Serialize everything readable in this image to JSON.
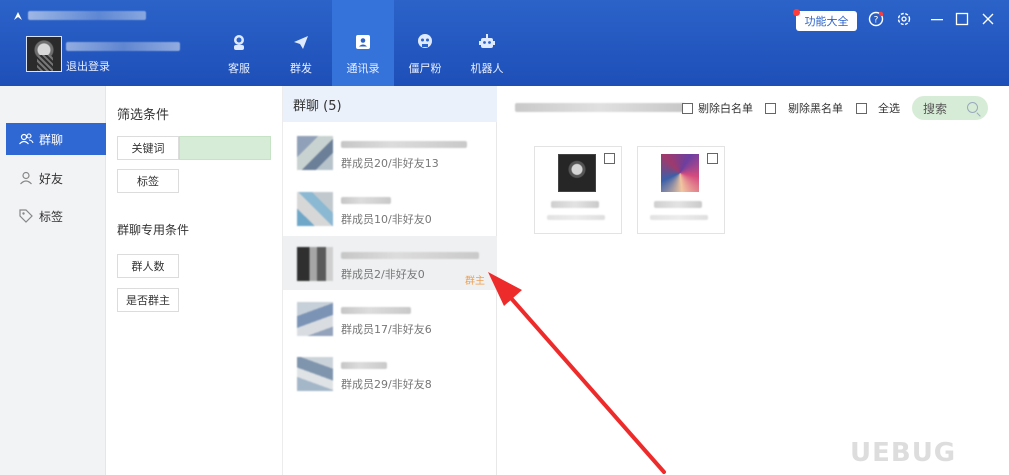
{
  "header": {
    "logout_label": "退出登录",
    "nav": [
      {
        "label": "客服",
        "icon": "customer-service-icon",
        "active": false
      },
      {
        "label": "群发",
        "icon": "send-plane-icon",
        "active": false
      },
      {
        "label": "通讯录",
        "icon": "contacts-icon",
        "active": true
      },
      {
        "label": "僵尸粉",
        "icon": "zombie-icon",
        "active": false
      },
      {
        "label": "机器人",
        "icon": "robot-icon",
        "active": false
      }
    ],
    "func_button": "功能大全",
    "accent": "#2b63c9"
  },
  "sidebar": {
    "items": [
      {
        "label": "群聊",
        "icon": "group-icon",
        "active": true
      },
      {
        "label": "好友",
        "icon": "person-icon",
        "active": false
      },
      {
        "label": "标签",
        "icon": "tag-icon",
        "active": false
      }
    ]
  },
  "filter": {
    "title": "筛选条件",
    "keyword_label": "关键词",
    "tag_label": "标签",
    "group_conditions_title": "群聊专用条件",
    "group_member_count_label": "群人数",
    "is_owner_label": "是否群主"
  },
  "group_list": {
    "header": "群聊 (5)",
    "items": [
      {
        "sub": "群成员20/非好友13",
        "tag": ""
      },
      {
        "sub": "群成员10/非好友0",
        "tag": ""
      },
      {
        "sub": "群成员2/非好友0",
        "tag": "群主"
      },
      {
        "sub": "群成员17/非好友6",
        "tag": ""
      },
      {
        "sub": "群成员29/非好友8",
        "tag": ""
      }
    ]
  },
  "toolbar": {
    "remove_whitelist": "剔除白名单",
    "remove_blacklist": "剔除黑名单",
    "select_all": "全选",
    "search": "搜索"
  },
  "watermark": "UEBUG"
}
